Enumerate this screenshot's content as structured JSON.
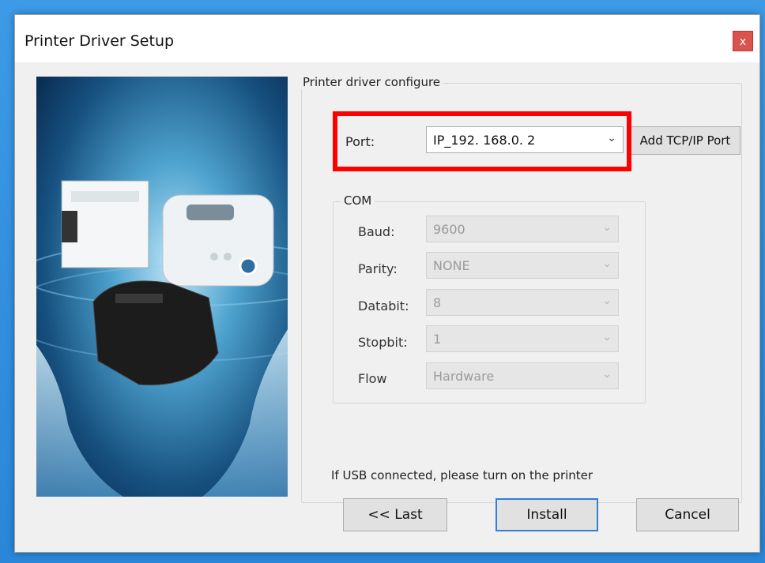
{
  "window": {
    "title": "Printer Driver Setup",
    "close_label": "x"
  },
  "config_group": {
    "legend": "Printer driver configure",
    "port_label": "Port:",
    "port_value": "IP_192. 168.0. 2",
    "add_port_button": "Add TCP/IP Port"
  },
  "com_group": {
    "legend": "COM",
    "fields": [
      {
        "label": "Baud:",
        "value": "9600"
      },
      {
        "label": "Parity:",
        "value": "NONE"
      },
      {
        "label": "Databit:",
        "value": "8"
      },
      {
        "label": "Stopbit:",
        "value": "1"
      },
      {
        "label": "Flow",
        "value": "Hardware"
      }
    ]
  },
  "notice": "If USB connected, please turn on the printer",
  "buttons": {
    "last": "<< Last",
    "install": "Install",
    "cancel": "Cancel"
  },
  "icons": {
    "dropdown": "chevron-down-icon",
    "close": "close-icon"
  },
  "colors": {
    "highlight": "#ff0000",
    "default_button_border": "#2f7fd4",
    "close_button": "#d9534f"
  }
}
